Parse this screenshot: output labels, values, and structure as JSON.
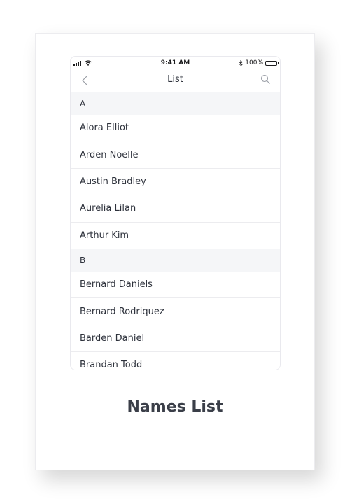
{
  "status_bar": {
    "time": "9:41 AM",
    "battery_percent": "100%"
  },
  "nav": {
    "title": "List",
    "back_icon": "chevron-left-icon",
    "search_icon": "search-icon"
  },
  "sections": [
    {
      "header": "A",
      "items": [
        "Alora Elliot",
        "Arden Noelle",
        "Austin Bradley",
        "Aurelia Lilan",
        "Arthur Kim"
      ]
    },
    {
      "header": "B",
      "items": [
        "Bernard Daniels",
        "Bernard Rodriquez",
        "Barden Daniel",
        "Brandan Todd"
      ]
    }
  ],
  "caption": "Names List",
  "colors": {
    "section_bg": "#f5f6f8",
    "text": "#2e323c",
    "divider": "#ececef"
  }
}
